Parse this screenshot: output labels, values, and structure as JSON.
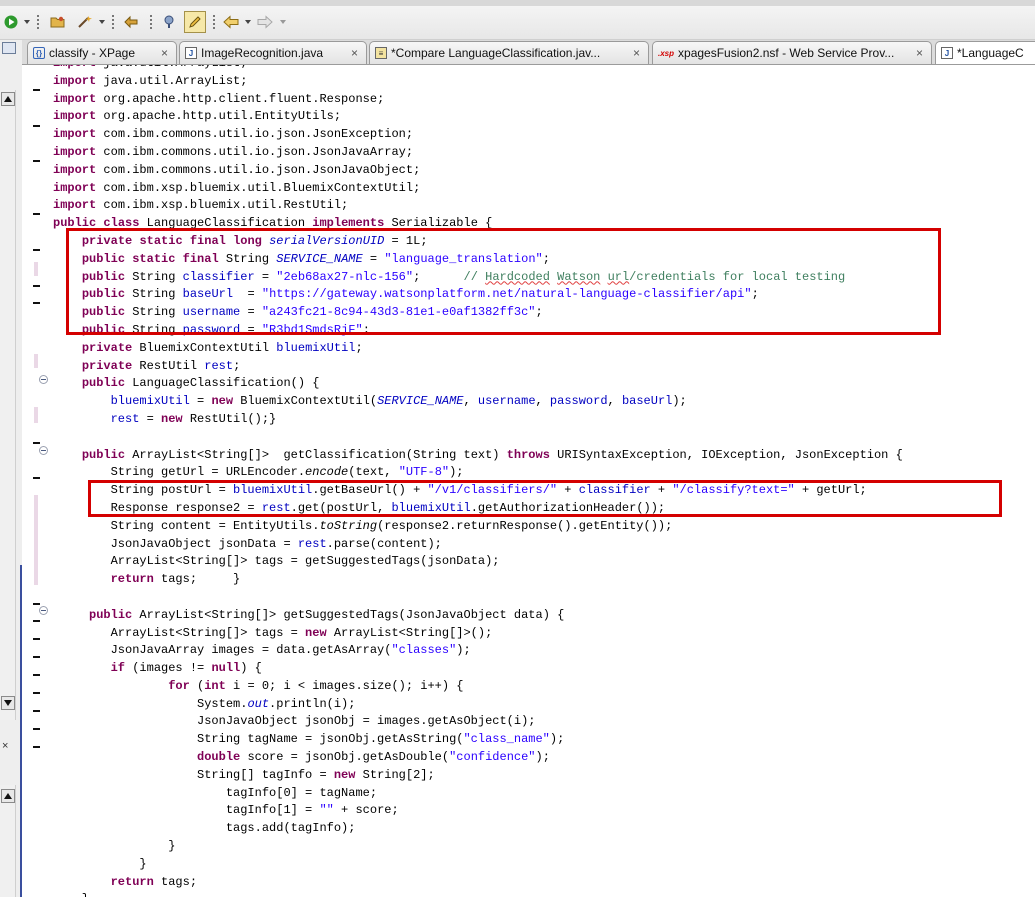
{
  "tabs": [
    {
      "label": "classify - XPage",
      "icon": "xpage-icon",
      "active": false
    },
    {
      "label": "ImageRecognition.java",
      "icon": "java-file-icon",
      "active": false
    },
    {
      "label": "*Compare LanguageClassification.jav...",
      "icon": "compare-icon",
      "active": false
    },
    {
      "label": "xpagesFusion2.nsf - Web Service Prov...",
      "prefix": ".xsp",
      "icon": "xsp-icon",
      "active": false
    },
    {
      "label": "*LanguageC",
      "icon": "java-file-icon",
      "active": true
    }
  ],
  "tab_close_glyph": "×",
  "code_lines": [
    [
      {
        "t": "import java.util.ArrayList;",
        "k": "mix",
        "p": "import"
      }
    ],
    [
      {
        "t": "import",
        "c": "kw"
      },
      {
        "t": " java.util.ArrayList;"
      }
    ],
    [
      {
        "t": "import",
        "c": "kw"
      },
      {
        "t": " org.apache.http.client.fluent.Response;"
      }
    ],
    [
      {
        "t": "import",
        "c": "kw"
      },
      {
        "t": " org.apache.http.util.EntityUtils;"
      }
    ],
    [
      {
        "t": "import",
        "c": "kw"
      },
      {
        "t": " com.ibm.commons.util.io.json.JsonException;"
      }
    ],
    [
      {
        "t": "import",
        "c": "kw"
      },
      {
        "t": " com.ibm.commons.util.io.json.JsonJavaArray;"
      }
    ],
    [
      {
        "t": "import",
        "c": "kw"
      },
      {
        "t": " com.ibm.commons.util.io.json.JsonJavaObject;"
      }
    ],
    [
      {
        "t": "import",
        "c": "kw"
      },
      {
        "t": " com.ibm.xsp.bluemix.util.BluemixContextUtil;"
      }
    ],
    [
      {
        "t": "import",
        "c": "kw"
      },
      {
        "t": " com.ibm.xsp.bluemix.util.RestUtil;"
      }
    ],
    [
      {
        "t": "public",
        "c": "kw"
      },
      {
        "t": " "
      },
      {
        "t": "class",
        "c": "kw"
      },
      {
        "t": " LanguageClassification "
      },
      {
        "t": "implements",
        "c": "kw"
      },
      {
        "t": " Serializable {"
      }
    ],
    [
      {
        "t": "    "
      },
      {
        "t": "private",
        "c": "kw"
      },
      {
        "t": " "
      },
      {
        "t": "static",
        "c": "kw"
      },
      {
        "t": " "
      },
      {
        "t": "final",
        "c": "kw"
      },
      {
        "t": " "
      },
      {
        "t": "long",
        "c": "kw"
      },
      {
        "t": " "
      },
      {
        "t": "serialVersionUID",
        "c": "sfld"
      },
      {
        "t": " = 1L;"
      }
    ],
    [
      {
        "t": "    "
      },
      {
        "t": "public",
        "c": "kw"
      },
      {
        "t": " "
      },
      {
        "t": "static",
        "c": "kw"
      },
      {
        "t": " "
      },
      {
        "t": "final",
        "c": "kw"
      },
      {
        "t": " String "
      },
      {
        "t": "SERVICE_NAME",
        "c": "sfld"
      },
      {
        "t": " = "
      },
      {
        "t": "\"language_translation\"",
        "c": "str"
      },
      {
        "t": ";"
      }
    ],
    [
      {
        "t": "    "
      },
      {
        "t": "public",
        "c": "kw"
      },
      {
        "t": " String "
      },
      {
        "t": "classifier",
        "c": "fld"
      },
      {
        "t": " = "
      },
      {
        "t": "\"2eb68ax27-nlc-156\"",
        "c": "str"
      },
      {
        "t": ";      "
      },
      {
        "t": "// ",
        "c": "cmt"
      },
      {
        "t": "Hardcoded",
        "c": "cmt spell"
      },
      {
        "t": " ",
        "c": "cmt"
      },
      {
        "t": "Watson",
        "c": "cmt spell"
      },
      {
        "t": " ",
        "c": "cmt"
      },
      {
        "t": "url",
        "c": "cmt spell"
      },
      {
        "t": "/credentials for local testing",
        "c": "cmt"
      }
    ],
    [
      {
        "t": "    "
      },
      {
        "t": "public",
        "c": "kw"
      },
      {
        "t": " String "
      },
      {
        "t": "baseUrl",
        "c": "fld"
      },
      {
        "t": "  = "
      },
      {
        "t": "\"https://gateway.watsonplatform.net/natural-language-classifier/api\"",
        "c": "str"
      },
      {
        "t": ";"
      }
    ],
    [
      {
        "t": "    "
      },
      {
        "t": "public",
        "c": "kw"
      },
      {
        "t": " String "
      },
      {
        "t": "username",
        "c": "fld"
      },
      {
        "t": " = "
      },
      {
        "t": "\"a243fc21-8c94-43d3-81e1-e0af1382ff3c\"",
        "c": "str"
      },
      {
        "t": ";"
      }
    ],
    [
      {
        "t": "    "
      },
      {
        "t": "public",
        "c": "kw"
      },
      {
        "t": " String "
      },
      {
        "t": "password",
        "c": "fld"
      },
      {
        "t": " = "
      },
      {
        "t": "\"R3bd1SmdsRjF\"",
        "c": "str"
      },
      {
        "t": ";"
      }
    ],
    [
      {
        "t": "    "
      },
      {
        "t": "private",
        "c": "kw"
      },
      {
        "t": " BluemixContextUtil "
      },
      {
        "t": "bluemixUtil",
        "c": "fld"
      },
      {
        "t": ";"
      }
    ],
    [
      {
        "t": "    "
      },
      {
        "t": "private",
        "c": "kw"
      },
      {
        "t": " RestUtil "
      },
      {
        "t": "rest",
        "c": "fld"
      },
      {
        "t": ";"
      }
    ],
    [
      {
        "t": "    "
      },
      {
        "t": "public",
        "c": "kw"
      },
      {
        "t": " LanguageClassification() {"
      }
    ],
    [
      {
        "t": "        "
      },
      {
        "t": "bluemixUtil",
        "c": "fld"
      },
      {
        "t": " = "
      },
      {
        "t": "new",
        "c": "kw"
      },
      {
        "t": " BluemixContextUtil("
      },
      {
        "t": "SERVICE_NAME",
        "c": "sfld"
      },
      {
        "t": ", "
      },
      {
        "t": "username",
        "c": "fld"
      },
      {
        "t": ", "
      },
      {
        "t": "password",
        "c": "fld"
      },
      {
        "t": ", "
      },
      {
        "t": "baseUrl",
        "c": "fld"
      },
      {
        "t": ");"
      }
    ],
    [
      {
        "t": "        "
      },
      {
        "t": "rest",
        "c": "fld"
      },
      {
        "t": " = "
      },
      {
        "t": "new",
        "c": "kw"
      },
      {
        "t": " RestUtil();}"
      }
    ],
    [
      {
        "t": ""
      }
    ],
    [
      {
        "t": "    "
      },
      {
        "t": "public",
        "c": "kw"
      },
      {
        "t": " ArrayList<String[]>  getClassification(String text) "
      },
      {
        "t": "throws",
        "c": "kw"
      },
      {
        "t": " URISyntaxException, IOException, JsonException {"
      }
    ],
    [
      {
        "t": "        String getUrl = URLEncoder."
      },
      {
        "t": "encode",
        "c": "smeth"
      },
      {
        "t": "(text, "
      },
      {
        "t": "\"UTF-8\"",
        "c": "str"
      },
      {
        "t": ");"
      }
    ],
    [
      {
        "t": "        String postUrl = "
      },
      {
        "t": "bluemixUtil",
        "c": "fld"
      },
      {
        "t": ".getBaseUrl() + "
      },
      {
        "t": "\"/v1/classifiers/\"",
        "c": "str"
      },
      {
        "t": " + "
      },
      {
        "t": "classifier",
        "c": "fld"
      },
      {
        "t": " + "
      },
      {
        "t": "\"/classify?text=\"",
        "c": "str"
      },
      {
        "t": " + getUrl;"
      }
    ],
    [
      {
        "t": "        Response response2 = "
      },
      {
        "t": "rest",
        "c": "fld"
      },
      {
        "t": ".get(postUrl, "
      },
      {
        "t": "bluemixUtil",
        "c": "fld"
      },
      {
        "t": ".getAuthorizationHeader());"
      }
    ],
    [
      {
        "t": "        String content = EntityUtils."
      },
      {
        "t": "toString",
        "c": "smeth"
      },
      {
        "t": "(response2.returnResponse().getEntity());"
      }
    ],
    [
      {
        "t": "        JsonJavaObject jsonData = "
      },
      {
        "t": "rest",
        "c": "fld"
      },
      {
        "t": ".parse(content);"
      }
    ],
    [
      {
        "t": "        ArrayList<String[]> tags = getSuggestedTags(jsonData);"
      }
    ],
    [
      {
        "t": "        "
      },
      {
        "t": "return",
        "c": "kw"
      },
      {
        "t": " tags;     }"
      }
    ],
    [
      {
        "t": ""
      }
    ],
    [
      {
        "t": "     "
      },
      {
        "t": "public",
        "c": "kw"
      },
      {
        "t": " ArrayList<String[]> getSuggestedTags(JsonJavaObject data) {"
      }
    ],
    [
      {
        "t": "        ArrayList<String[]> tags = "
      },
      {
        "t": "new",
        "c": "kw"
      },
      {
        "t": " ArrayList<String[]>();"
      }
    ],
    [
      {
        "t": "        JsonJavaArray images = data.getAsArray("
      },
      {
        "t": "\"classes\"",
        "c": "str"
      },
      {
        "t": ");"
      }
    ],
    [
      {
        "t": "        "
      },
      {
        "t": "if",
        "c": "kw"
      },
      {
        "t": " (images != "
      },
      {
        "t": "null",
        "c": "kw"
      },
      {
        "t": ") {"
      }
    ],
    [
      {
        "t": "                "
      },
      {
        "t": "for",
        "c": "kw"
      },
      {
        "t": " ("
      },
      {
        "t": "int",
        "c": "kw"
      },
      {
        "t": " i = 0; i < images.size(); i++) {"
      }
    ],
    [
      {
        "t": "                    System."
      },
      {
        "t": "out",
        "c": "sfld"
      },
      {
        "t": ".println(i);"
      }
    ],
    [
      {
        "t": "                    JsonJavaObject jsonObj = images.getAsObject(i);"
      }
    ],
    [
      {
        "t": "                    String tagName = jsonObj.getAsString("
      },
      {
        "t": "\"class_name\"",
        "c": "str"
      },
      {
        "t": ");"
      }
    ],
    [
      {
        "t": "                    "
      },
      {
        "t": "double",
        "c": "kw"
      },
      {
        "t": " score = jsonObj.getAsDouble("
      },
      {
        "t": "\"confidence\"",
        "c": "str"
      },
      {
        "t": ");"
      }
    ],
    [
      {
        "t": "                    String[] tagInfo = "
      },
      {
        "t": "new",
        "c": "kw"
      },
      {
        "t": " String[2];"
      }
    ],
    [
      {
        "t": "                        tagInfo[0] = tagName;"
      }
    ],
    [
      {
        "t": "                        tagInfo[1] = "
      },
      {
        "t": "\"\"",
        "c": "str"
      },
      {
        "t": " + score;"
      }
    ],
    [
      {
        "t": "                        tags.add(tagInfo);"
      }
    ],
    [
      {
        "t": "                }"
      }
    ],
    [
      {
        "t": "            }"
      }
    ],
    [
      {
        "t": "        "
      },
      {
        "t": "return",
        "c": "kw"
      },
      {
        "t": " tags;"
      }
    ],
    [
      {
        "t": "    }"
      }
    ]
  ],
  "colors": {
    "keyword": "#7f0055",
    "string": "#2a00ff",
    "field": "#0000c0",
    "comment": "#3f7f5f",
    "highlight_box": "#d40000"
  },
  "toolbar_icons": [
    "run-icon",
    "open-folder-icon",
    "wand-icon",
    "back-in-history-icon",
    "pin-icon",
    "edit-pencil-icon",
    "back-arrow-icon",
    "forward-arrow-icon"
  ]
}
